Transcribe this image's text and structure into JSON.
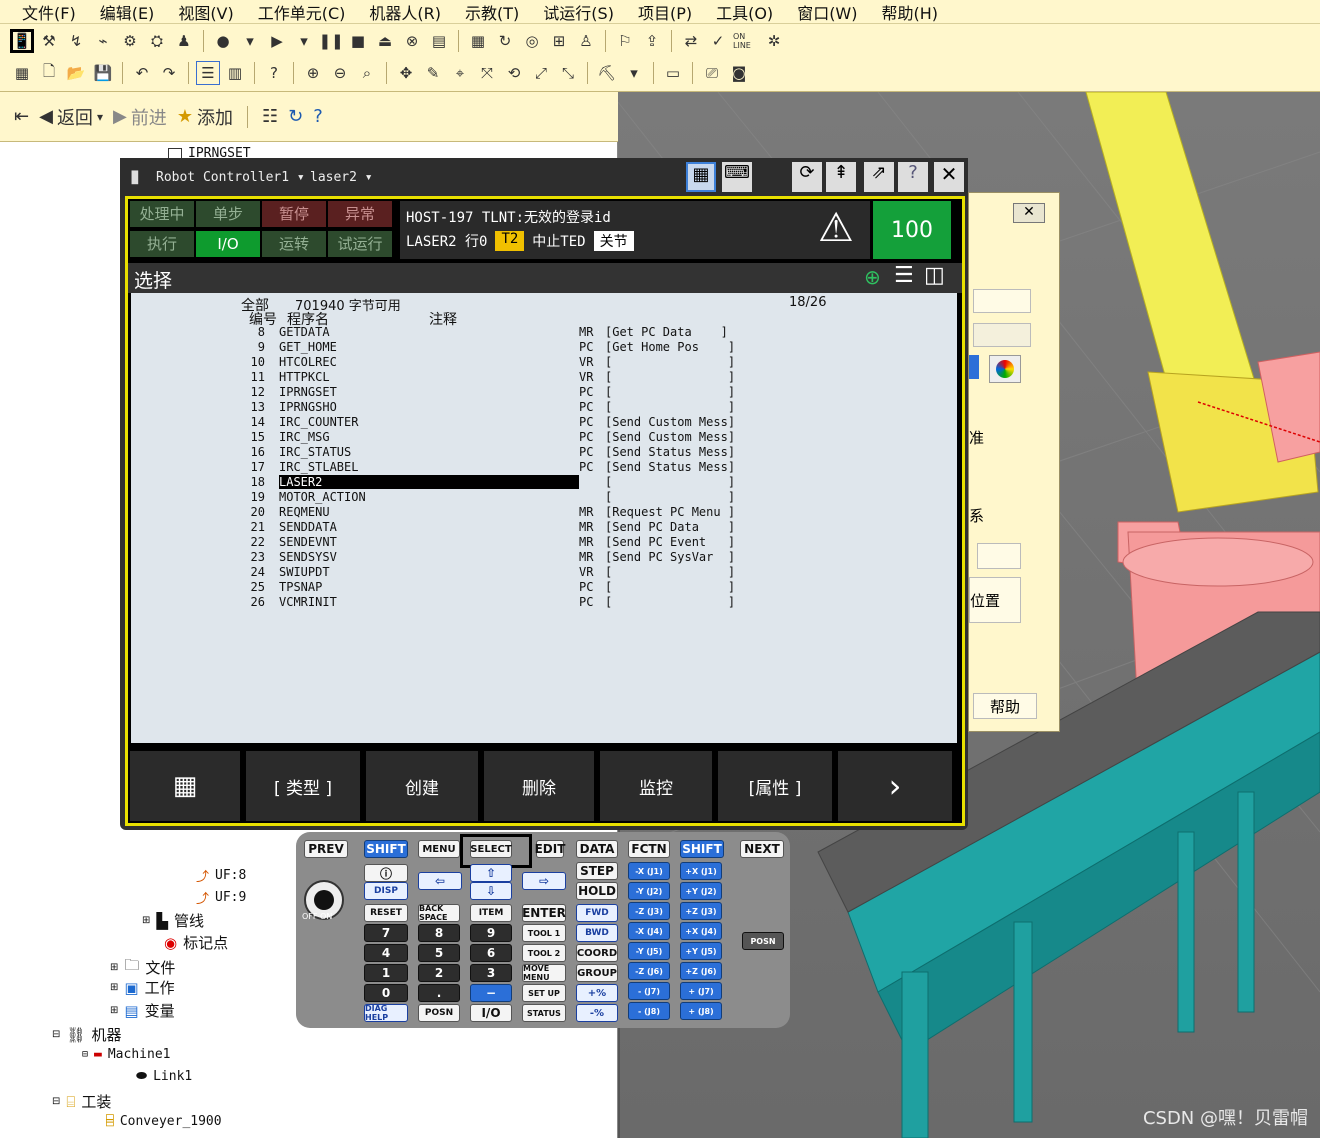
{
  "menu": [
    "文件(F)",
    "编辑(E)",
    "视图(V)",
    "工作单元(C)",
    "机器人(R)",
    "示教(T)",
    "试运行(S)",
    "项目(P)",
    "工具(O)",
    "窗口(W)",
    "帮助(H)"
  ],
  "toolbar": {
    "online_label": "ON LINE"
  },
  "leftnav": {
    "back": "返回",
    "forward": "前进",
    "add": "添加"
  },
  "tree": {
    "top_item": "IPRNGSET",
    "uf8": "UF:8",
    "uf9": "UF:9",
    "pipeline": "管线",
    "markers": "标记点",
    "files": "文件",
    "work": "工作",
    "variables": "变量",
    "robots": "机器",
    "machine1": "Machine1",
    "link1": "Link1",
    "tooling": "工装",
    "conveyor": "Conveyer_1900"
  },
  "pendant": {
    "controller": "Robot Controller1",
    "program": "laser2",
    "status_left": [
      "处理中",
      "单步",
      "暂停",
      "异常",
      "执行",
      "I/O",
      "运转",
      "试运行"
    ],
    "alarm_line": "HOST-197 TLNT:无效的登录id",
    "prog_line_prefix": "LASER2 行0",
    "t2": "T2",
    "halt": "中止TED",
    "joint": "关节",
    "override": "100",
    "screen_title": "选择",
    "header_all": "全部",
    "header_bytes": "701940 字节可用",
    "header_page": "18/26",
    "col_no": "编号",
    "col_name": "程序名",
    "col_comment": "注释",
    "programs": [
      {
        "no": "8",
        "name": "GETDATA",
        "type": "MR",
        "comment": "[Get PC Data    ]"
      },
      {
        "no": "9",
        "name": "GET_HOME",
        "type": "PC",
        "comment": "[Get Home Pos    ]"
      },
      {
        "no": "10",
        "name": "HTCOLREC",
        "type": "VR",
        "comment": "[                ]"
      },
      {
        "no": "11",
        "name": "HTTPKCL",
        "type": "VR",
        "comment": "[                ]"
      },
      {
        "no": "12",
        "name": "IPRNGSET",
        "type": "PC",
        "comment": "[                ]"
      },
      {
        "no": "13",
        "name": "IPRNGSHO",
        "type": "PC",
        "comment": "[                ]"
      },
      {
        "no": "14",
        "name": "IRC_COUNTER",
        "type": "PC",
        "comment": "[Send Custom Mess]"
      },
      {
        "no": "15",
        "name": "IRC_MSG",
        "type": "PC",
        "comment": "[Send Custom Mess]"
      },
      {
        "no": "16",
        "name": "IRC_STATUS",
        "type": "PC",
        "comment": "[Send Status Mess]"
      },
      {
        "no": "17",
        "name": "IRC_STLABEL",
        "type": "PC",
        "comment": "[Send Status Mess]"
      },
      {
        "no": "18",
        "name": "LASER2",
        "type": "",
        "comment": "[                ]"
      },
      {
        "no": "19",
        "name": "MOTOR_ACTION",
        "type": "",
        "comment": "[                ]"
      },
      {
        "no": "20",
        "name": "REQMENU",
        "type": "MR",
        "comment": "[Request PC Menu ]"
      },
      {
        "no": "21",
        "name": "SENDDATA",
        "type": "MR",
        "comment": "[Send PC Data    ]"
      },
      {
        "no": "22",
        "name": "SENDEVNT",
        "type": "MR",
        "comment": "[Send PC Event   ]"
      },
      {
        "no": "23",
        "name": "SENDSYSV",
        "type": "MR",
        "comment": "[Send PC SysVar  ]"
      },
      {
        "no": "24",
        "name": "SWIUPDT",
        "type": "VR",
        "comment": "[                ]"
      },
      {
        "no": "25",
        "name": "TPSNAP",
        "type": "PC",
        "comment": "[                ]"
      },
      {
        "no": "26",
        "name": "VCMRINIT",
        "type": "PC",
        "comment": "[                ]"
      }
    ],
    "fkeys": [
      "[ 类型 ]",
      "创建",
      "删除",
      "监控",
      "[属性 ]"
    ]
  },
  "keypad": {
    "prev": "PREV",
    "shift": "SHIFT",
    "menu": "MENU",
    "select": "SELECT",
    "edit": "EDIT",
    "data": "DATA",
    "fctn": "FCTN",
    "next": "NEXT",
    "disp": "DISP",
    "step": "STEP",
    "hold": "HOLD",
    "reset": "RESET",
    "backspace": "BACK SPACE",
    "item": "ITEM",
    "enter": "ENTER",
    "fwd": "FWD",
    "bwd": "BWD",
    "tool1": "TOOL 1",
    "tool2": "TOOL 2",
    "coord": "COORD",
    "movemenu": "MOVE MENU",
    "group": "GROUP",
    "setup": "SET UP",
    "diaghelp": "DIAG HELP",
    "posn": "POSN",
    "io": "I/O",
    "status": "STATUS",
    "digits": [
      "7",
      "8",
      "9",
      "4",
      "5",
      "6",
      "1",
      "2",
      "3",
      "0",
      "."
    ],
    "offon": "OFF ON",
    "jog_pos": [
      "+X (J1)",
      "+Y (J2)",
      "+Z (J3)",
      "+X (J4)",
      "+Y (J5)",
      "+Z (J6)",
      "+ (J7)",
      "+ (J8)"
    ],
    "jog_neg": [
      "-X (J1)",
      "-Y (J2)",
      "-Z (J3)",
      "-X (J4)",
      "-Y (J5)",
      "-Z (J6)",
      "- (J7)",
      "- (J8)"
    ],
    "pct_up": "+%",
    "pct_down": "-%"
  },
  "bgdialog": {
    "label1": "准",
    "label2": "系",
    "label3": "位置",
    "help": "帮助"
  },
  "watermark": "CSDN @嘿！贝雷帽"
}
